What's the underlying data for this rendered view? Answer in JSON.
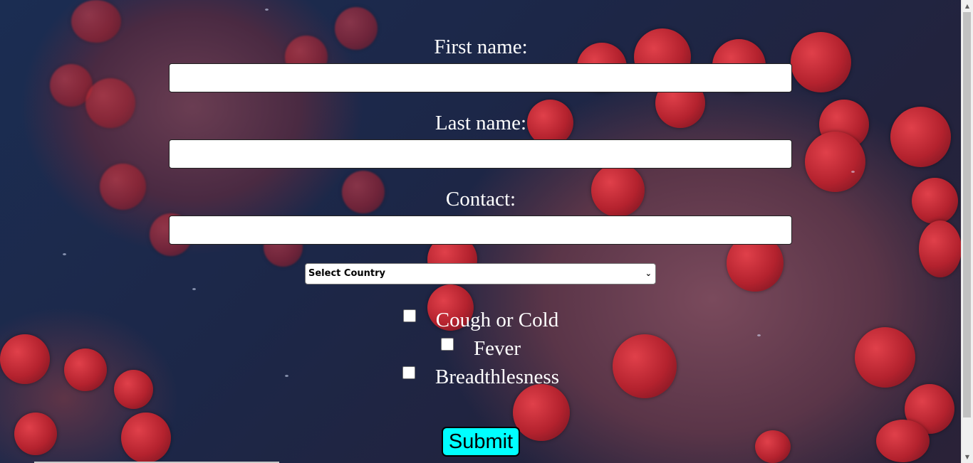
{
  "form": {
    "first_name": {
      "label": "First name:",
      "value": "",
      "placeholder": ""
    },
    "last_name": {
      "label": "Last name:",
      "value": "",
      "placeholder": ""
    },
    "contact": {
      "label": "Contact:",
      "value": "",
      "placeholder": ""
    },
    "country": {
      "selected": "Select Country"
    },
    "symptoms": [
      {
        "label": "Cough or Cold",
        "checked": false
      },
      {
        "label": "Fever",
        "checked": false
      },
      {
        "label": "Breadthlesness",
        "checked": false
      }
    ],
    "submit_label": "Submit"
  },
  "colors": {
    "label_text": "#ffffff",
    "submit_background": "#00ffff",
    "background_dark": "#1c2748",
    "virus_red": "#c0262f"
  },
  "icons": {
    "select_chevron": "chevron-down-icon",
    "scroll_up": "scroll-up-arrow-icon",
    "scroll_down": "scroll-down-arrow-icon"
  }
}
